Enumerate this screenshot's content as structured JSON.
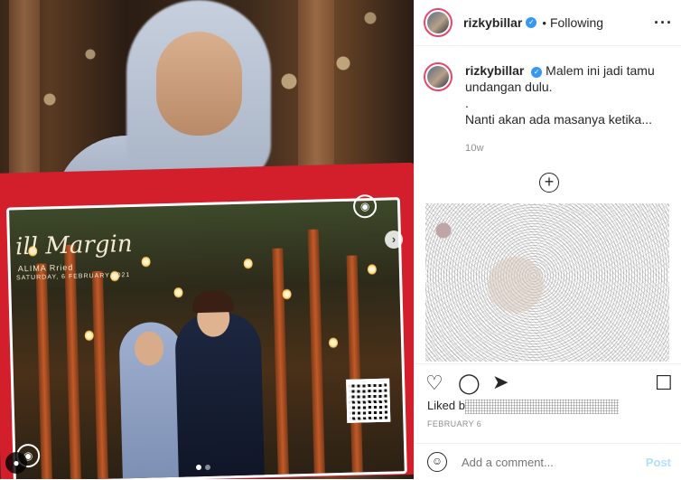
{
  "post": {
    "username": "rizkybillar",
    "follow_status": "Following",
    "caption_username": "rizkybillar",
    "caption_line1": "Malem ini jadi tamu",
    "caption_line2": "undangan dulu.",
    "caption_line3": ".",
    "caption_line4": "Nanti akan ada masanya ketika...",
    "time_ago": "10w",
    "liked_by_prefix": "Liked b",
    "date": "FEBRUARY 6",
    "comment_placeholder": "Add a comment...",
    "post_label": "Post"
  },
  "photo": {
    "card_title": "ill Margin",
    "card_subtitle": "ALIMA Rried",
    "card_date": "SATURDAY, 6 FEBRUARY 2021",
    "carousel_count": 2,
    "carousel_active": 0
  },
  "icons": {
    "verified": "verified-badge-icon",
    "more": "more-options-icon",
    "add": "add-circle-icon",
    "like": "heart-icon",
    "comment": "comment-icon",
    "share": "share-icon",
    "save": "bookmark-icon",
    "emoji": "emoji-icon",
    "next": "chevron-right-icon",
    "tags": "user-tag-icon"
  },
  "colors": {
    "verified": "#3897f0",
    "post_btn": "#b2dffc",
    "story_ring": "#e8476c",
    "card_red": "#d31f2c"
  }
}
